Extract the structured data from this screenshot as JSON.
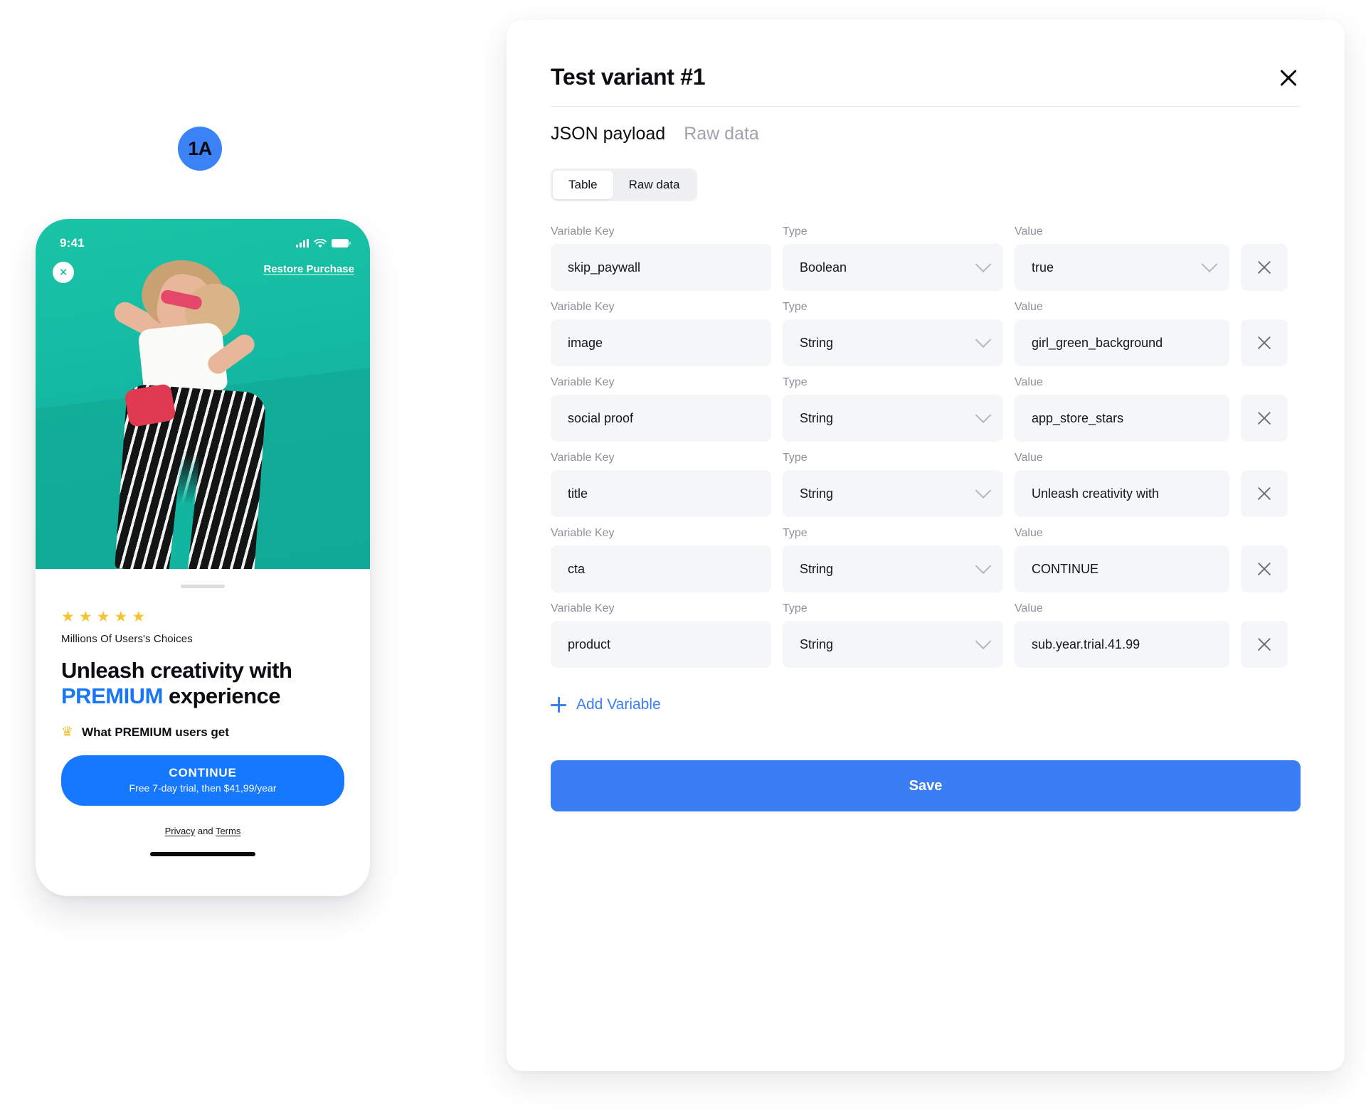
{
  "preview": {
    "variant_badge": "1A",
    "phone": {
      "status_bar": {
        "time": "9:41",
        "signal_icon": "cellular-signal-icon",
        "wifi_icon": "wifi-icon",
        "battery_icon": "battery-icon"
      },
      "close_icon": "close-icon",
      "restore_label": "Restore Purchase",
      "stars": [
        "★",
        "★",
        "★",
        "★",
        "★"
      ],
      "social_proof": "Millions Of Users's Choices",
      "headline_part1": "Unleash creativity with ",
      "headline_highlight": "PREMIUM",
      "headline_part2": " experience",
      "crown_icon": "crown-icon",
      "perk_text": "What PREMIUM users get",
      "cta_main": "CONTINUE",
      "cta_sub": "Free 7-day trial, then $41,99/year",
      "legal_privacy": "Privacy",
      "legal_and": " and ",
      "legal_terms": "Terms"
    }
  },
  "panel": {
    "title": "Test variant #1",
    "close_icon": "close-icon",
    "payload_tabs": [
      {
        "label": "JSON payload",
        "active": true
      },
      {
        "label": "Raw data",
        "active": false
      }
    ],
    "segmented": [
      {
        "label": "Table",
        "active": true
      },
      {
        "label": "Raw data",
        "active": false
      }
    ],
    "column_headers": {
      "key": "Variable Key",
      "type": "Type",
      "value": "Value"
    },
    "delete_icon": "close-icon",
    "chevron_icon": "chevron-down-icon",
    "rows": [
      {
        "key": "skip_paywall",
        "type": "Boolean",
        "value": "true",
        "value_is_select": true
      },
      {
        "key": "image",
        "type": "String",
        "value": "girl_green_background",
        "value_is_select": false
      },
      {
        "key": "social proof",
        "type": "String",
        "value": "app_store_stars",
        "value_is_select": false
      },
      {
        "key": "title",
        "type": "String",
        "value": "Unleash creativity with",
        "value_is_select": false
      },
      {
        "key": "cta",
        "type": "String",
        "value": "CONTINUE",
        "value_is_select": false
      },
      {
        "key": "product",
        "type": "String",
        "value": "sub.year.trial.41.99",
        "value_is_select": false
      }
    ],
    "add_variable_label": "Add Variable",
    "add_icon": "plus-icon",
    "save_label": "Save"
  },
  "colors": {
    "accent_blue": "#3b7ef4",
    "cta_blue": "#1677ff",
    "badge_blue": "#3b82f6",
    "hero_teal": "#16bfa5",
    "star_gold": "#f5c230",
    "field_gray": "#f5f6f7"
  }
}
